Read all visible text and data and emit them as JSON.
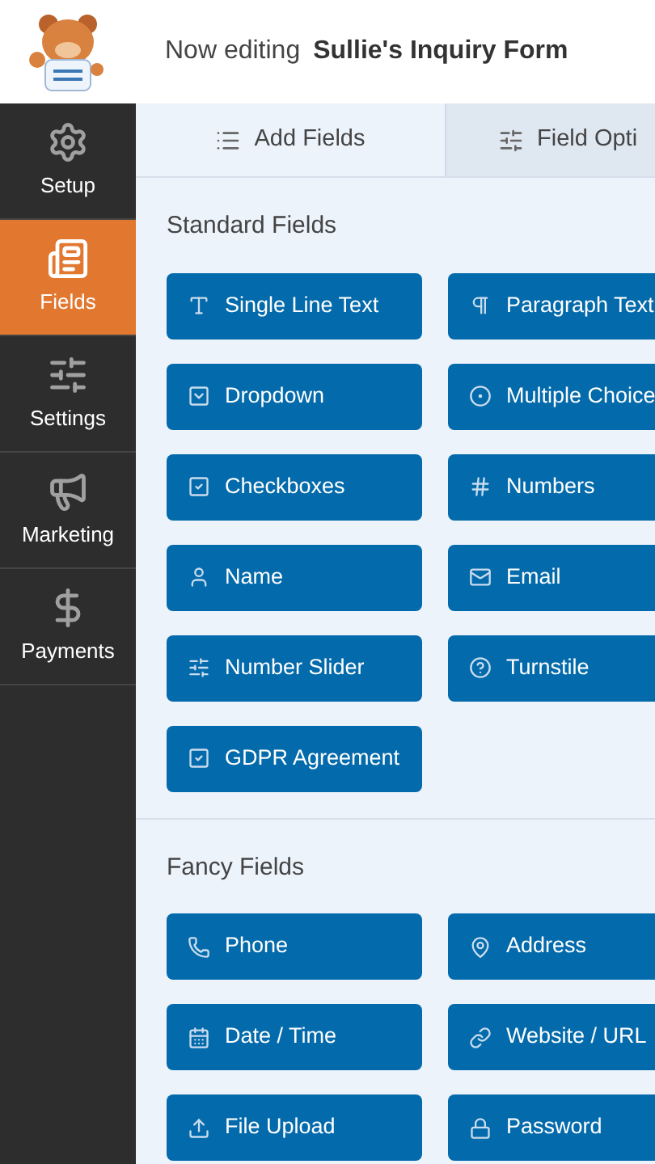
{
  "header": {
    "prefix": "Now editing",
    "form_name": "Sullie's Inquiry Form"
  },
  "sidebar": {
    "items": [
      {
        "label": "Setup",
        "selected": false
      },
      {
        "label": "Fields",
        "selected": true
      },
      {
        "label": "Settings",
        "selected": false
      },
      {
        "label": "Marketing",
        "selected": false
      },
      {
        "label": "Payments",
        "selected": false
      }
    ]
  },
  "tabs": [
    {
      "label": "Add Fields",
      "selected": true
    },
    {
      "label": "Field Opti",
      "selected": false
    }
  ],
  "sections": [
    {
      "title": "Standard Fields",
      "fields": [
        "Single Line Text",
        "Paragraph Text",
        "Dropdown",
        "Multiple Choice",
        "Checkboxes",
        "Numbers",
        "Name",
        "Email",
        "Number Slider",
        "Turnstile",
        "GDPR Agreement"
      ]
    },
    {
      "title": "Fancy Fields",
      "fields": [
        "Phone",
        "Address",
        "Date / Time",
        "Website / URL",
        "File Upload",
        "Password"
      ]
    }
  ]
}
